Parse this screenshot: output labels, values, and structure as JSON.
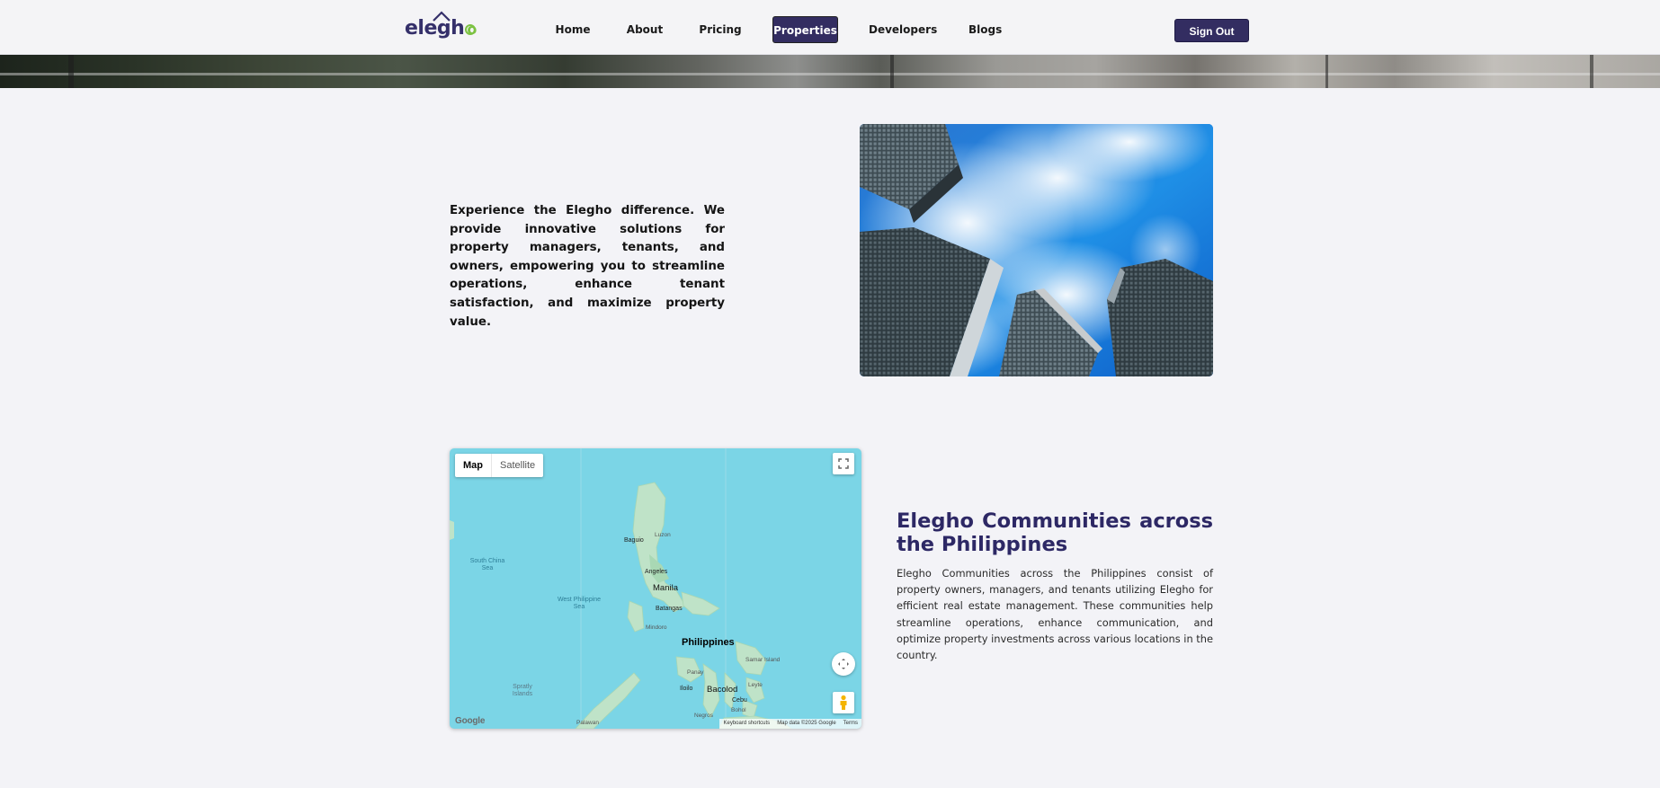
{
  "header": {
    "logo_text_1": "ele",
    "logo_text_2": "gh",
    "logo_text_3": "o",
    "nav": [
      {
        "label": "Home"
      },
      {
        "label": "About"
      },
      {
        "label": "Pricing"
      },
      {
        "label": "Properties",
        "active": true
      },
      {
        "label": "Developers"
      },
      {
        "label": "Blogs"
      }
    ],
    "sign_out_label": "Sign Out"
  },
  "intro": {
    "text": "Experience the Elegho difference. We provide innovative solutions for property managers, tenants, and owners, empowering you to streamline operations, enhance tenant satisfaction, and maximize property value."
  },
  "map": {
    "type_map": "Map",
    "type_satellite": "Satellite",
    "labels": {
      "south_china_sea": "South China Sea",
      "west_philippine_sea": "West Philippine Sea",
      "baguio": "Baguio",
      "luzon": "Luzon",
      "angeles": "Angeles",
      "manila": "Manila",
      "batangas": "Batangas",
      "mindoro": "Mindoro",
      "philippines": "Philippines",
      "samar_island": "Samar Island",
      "panay": "Panay",
      "iloilo": "Iloilo",
      "bacolod": "Bacolod",
      "leyte": "Leyte",
      "cebu": "Cebu",
      "bohol": "Bohol",
      "negros": "Negros",
      "spratly": "Spratly Islands",
      "palawan": "Palawan"
    },
    "footer": {
      "shortcuts": "Keyboard shortcuts",
      "data": "Map data ©2025 Google",
      "terms": "Terms"
    },
    "google_logo": "Google"
  },
  "communities": {
    "title": "Elegho Communities across the Philippines",
    "body": "Elegho Communities across the Philippines consist of property owners, managers, and tenants utilizing Elegho for efficient real estate management. These communities help streamline operations, enhance communication, and optimize property investments across various locations in the country."
  },
  "colors": {
    "brand_navy": "#332d61",
    "brand_green": "#7cc242",
    "title_navy": "#2d2865",
    "map_water": "#7bd5e6",
    "map_land": "#bfe3c8"
  }
}
